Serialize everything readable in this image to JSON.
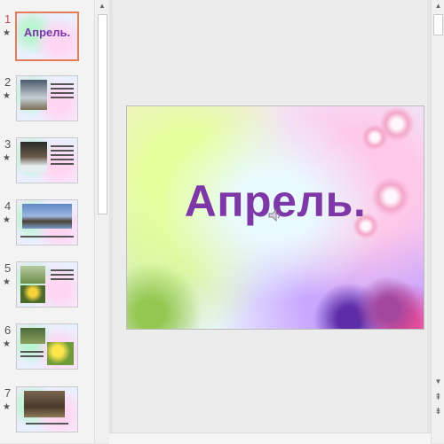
{
  "slides": [
    {
      "number": "1",
      "star": "★",
      "title": "Апрель."
    },
    {
      "number": "2",
      "star": "★"
    },
    {
      "number": "3",
      "star": "★"
    },
    {
      "number": "4",
      "star": "★"
    },
    {
      "number": "5",
      "star": "★"
    },
    {
      "number": "6",
      "star": "★"
    },
    {
      "number": "7",
      "star": "★"
    }
  ],
  "main_slide": {
    "title": "Апрель."
  },
  "icons": {
    "scroll_up": "▲",
    "scroll_down": "▼",
    "prev_slide": "⇞",
    "next_slide": "⇟",
    "speaker": "speaker-icon"
  },
  "colors": {
    "selected_border": "#e47c5a",
    "active_number": "#c0504d",
    "title_purple": "#7d37a6"
  }
}
